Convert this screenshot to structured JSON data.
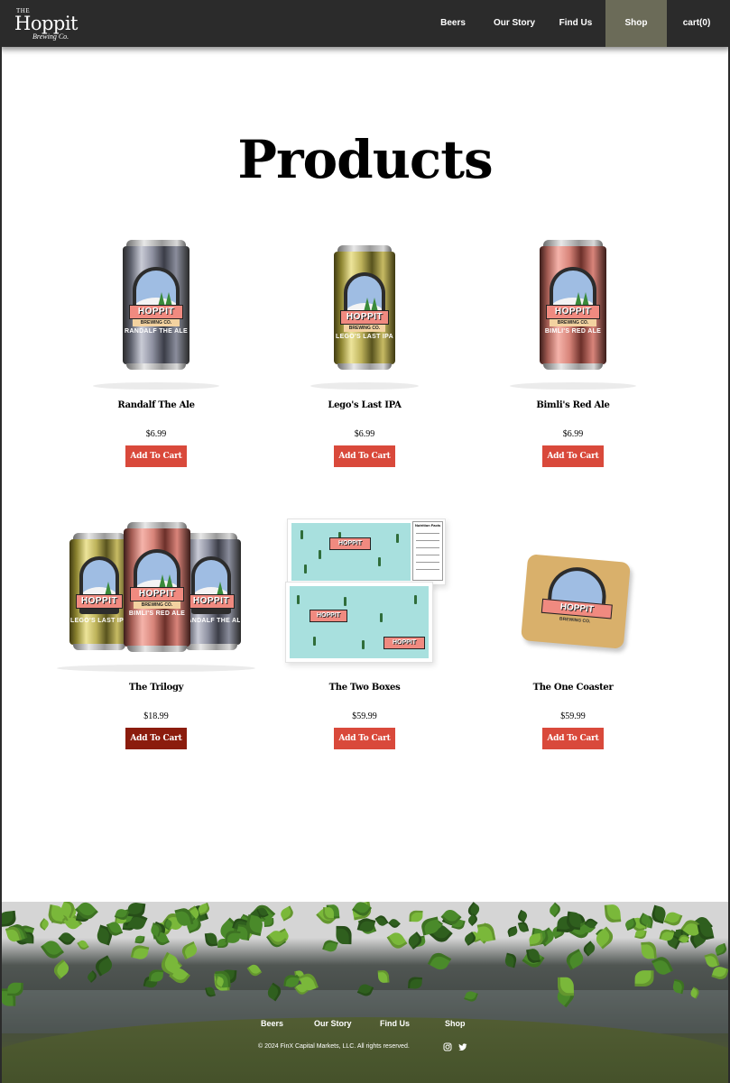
{
  "nav": {
    "logo": {
      "the": "THE",
      "name": "Hoppit",
      "sub": "Brewing Co."
    },
    "items": [
      "Beers",
      "Our Story",
      "Find Us",
      "Shop"
    ],
    "cart_label": "cart(0)",
    "active": "Shop",
    "active_color": "#6b6b58"
  },
  "page": {
    "title": "Products"
  },
  "products": [
    {
      "name": "Randalf The Ale",
      "price": "$6.99",
      "button": "Add To Cart",
      "can_label": "RANDALF THE ALE",
      "finish": "silver"
    },
    {
      "name": "Lego's Last IPA",
      "price": "$6.99",
      "button": "Add To Cart",
      "can_label": "LEGO'S LAST IPA",
      "finish": "gold"
    },
    {
      "name": "Bimli's Red Ale",
      "price": "$6.99",
      "button": "Add To Cart",
      "can_label": "BIMLI'S RED ALE",
      "finish": "rose"
    },
    {
      "name": "The Trilogy",
      "price": "$18.99",
      "button": "Add To Cart",
      "button_state": "hover"
    },
    {
      "name": "The Two Boxes",
      "price": "$59.99",
      "button": "Add To Cart",
      "box_panel": "Nutrition Facts"
    },
    {
      "name": "The One Coaster",
      "price": "$59.99",
      "button": "Add To Cart"
    }
  ],
  "branding": {
    "banner": "HOPPIT",
    "tag": "THE",
    "brewing": "BREWING CO."
  },
  "footer": {
    "links": [
      "Beers",
      "Our Story",
      "Find Us",
      "Shop"
    ],
    "copyright": "© 2024 FinX Capital Markets, LLC. All rights reserved.",
    "social": [
      "instagram-icon",
      "twitter-icon"
    ]
  },
  "colors": {
    "nav_bg": "#2b2b2b",
    "button": "#d9493b",
    "button_hover": "#8b1c0d"
  }
}
